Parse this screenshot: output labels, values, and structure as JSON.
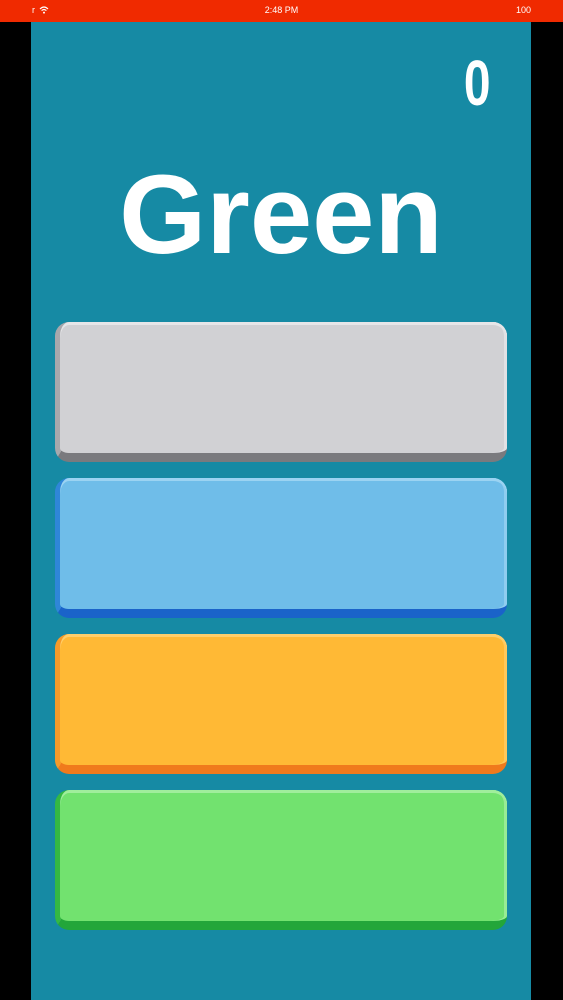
{
  "status_bar": {
    "time": "2:48 PM",
    "battery": "100",
    "carrier": "r"
  },
  "game": {
    "score": "0",
    "word": "Green"
  },
  "buttons": [
    {
      "color_name": "gray",
      "color": "#d1d1d4"
    },
    {
      "color_name": "blue",
      "color": "#6fbde9"
    },
    {
      "color_name": "orange",
      "color": "#ffb935"
    },
    {
      "color_name": "green",
      "color": "#72e26f"
    }
  ],
  "colors": {
    "background": "#168aa4",
    "status_bar": "#f02a00",
    "text": "#ffffff"
  }
}
